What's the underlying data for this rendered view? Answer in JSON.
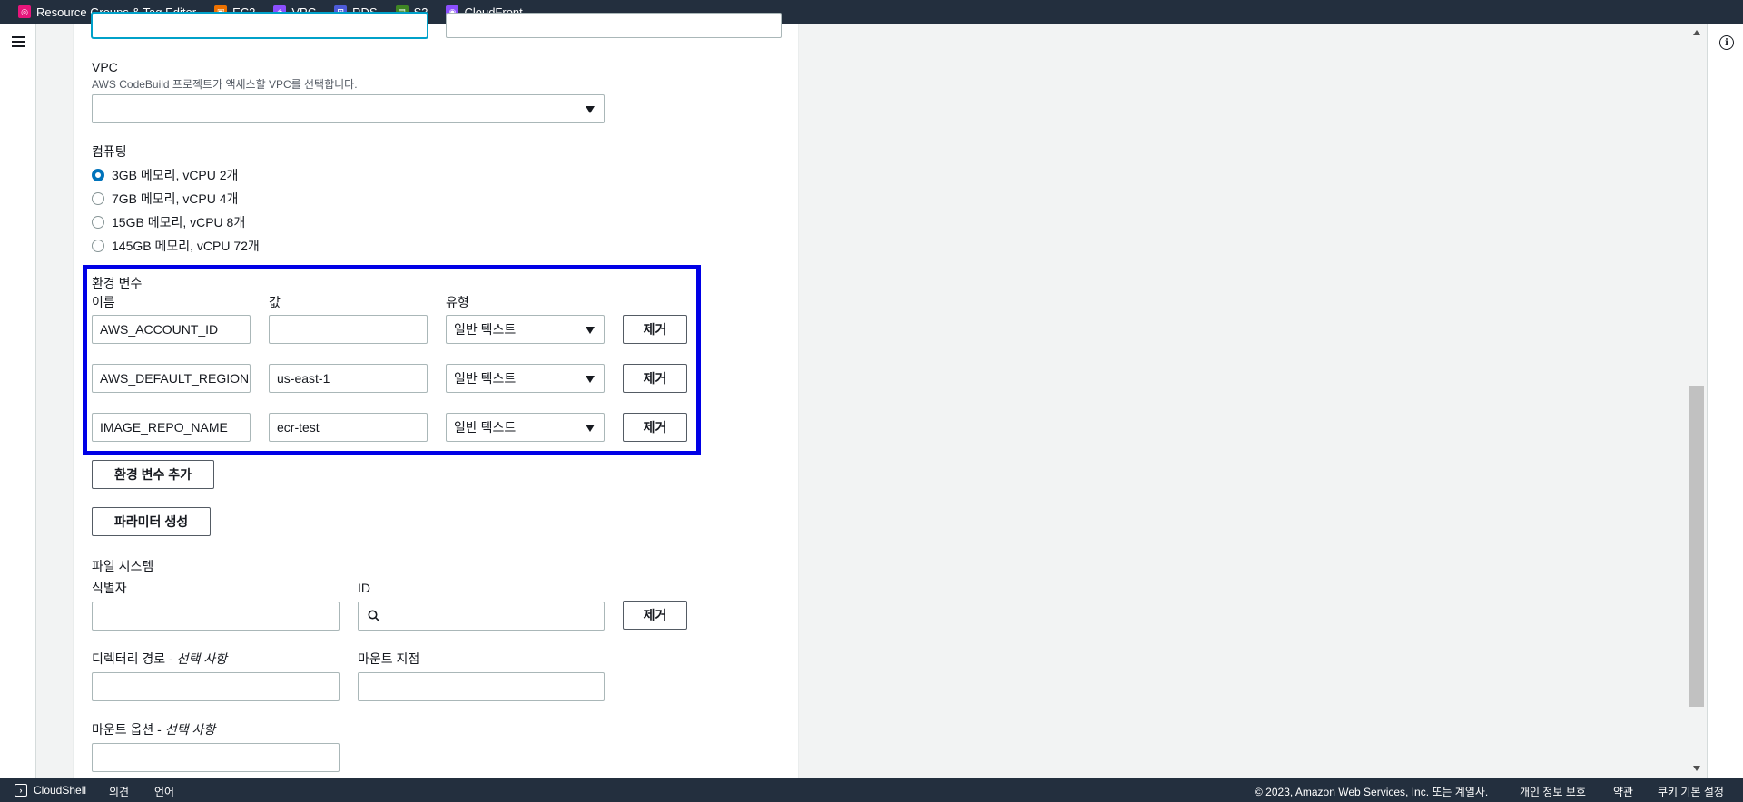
{
  "favorites": [
    {
      "label": "Resource Groups & Tag Editor",
      "color": "#e7157b",
      "icon": "resource-groups-icon"
    },
    {
      "label": "EC2",
      "color": "#ed7100",
      "icon": "ec2-icon"
    },
    {
      "label": "VPC",
      "color": "#8c4fff",
      "icon": "vpc-icon"
    },
    {
      "label": "RDS",
      "color": "#4d5bd9",
      "icon": "rds-icon"
    },
    {
      "label": "S3",
      "color": "#3f8624",
      "icon": "s3-icon"
    },
    {
      "label": "CloudFront",
      "color": "#8c4fff",
      "icon": "cloudfront-icon"
    }
  ],
  "vpc": {
    "label": "VPC",
    "description": "AWS CodeBuild 프로젝트가 액세스할 VPC를 선택합니다.",
    "value": ""
  },
  "compute": {
    "label": "컴퓨팅",
    "options": [
      {
        "label": "3GB 메모리, vCPU 2개",
        "selected": true
      },
      {
        "label": "7GB 메모리, vCPU 4개",
        "selected": false
      },
      {
        "label": "15GB 메모리, vCPU 8개",
        "selected": false
      },
      {
        "label": "145GB 메모리, vCPU 72개",
        "selected": false
      }
    ]
  },
  "env": {
    "title": "환경 변수",
    "col_name": "이름",
    "col_value": "값",
    "col_type": "유형",
    "rows": [
      {
        "name": "AWS_ACCOUNT_ID",
        "value": "",
        "type": "일반 텍스트",
        "remove": "제거"
      },
      {
        "name": "AWS_DEFAULT_REGION",
        "value": "us-east-1",
        "type": "일반 텍스트",
        "remove": "제거"
      },
      {
        "name": "IMAGE_REPO_NAME",
        "value": "ecr-test",
        "type": "일반 텍스트",
        "remove": "제거"
      }
    ],
    "add_button": "환경 변수 추가",
    "param_button": "파라미터 생성"
  },
  "filesystem": {
    "title": "파일 시스템",
    "identifier_label": "식별자",
    "id_label": "ID",
    "remove": "제거",
    "dir_path_label": "디렉터리 경로 -",
    "dir_path_optional": "선택 사항",
    "mount_point_label": "마운트 지점",
    "mount_options_label": "마운트 옵션 -",
    "mount_options_optional": "선택 사항"
  },
  "footer": {
    "cloudshell": "CloudShell",
    "feedback": "의견",
    "language": "언어",
    "copyright": "© 2023, Amazon Web Services, Inc. 또는 계열사.",
    "privacy": "개인 정보 보호",
    "terms": "약관",
    "cookies": "쿠키 기본 설정"
  },
  "accent_color": "#0073bb",
  "highlight_color": "#0000e6"
}
